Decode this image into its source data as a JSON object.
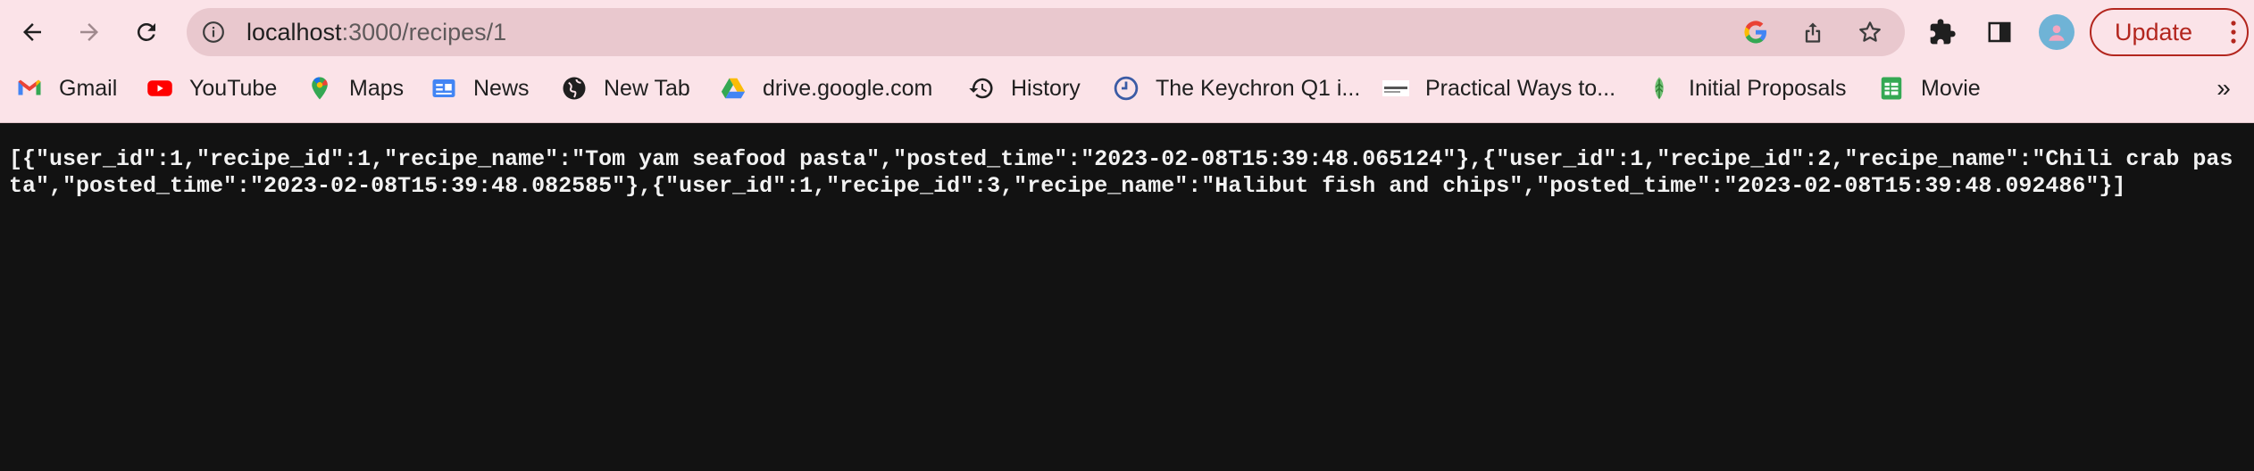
{
  "browser": {
    "url_host": "localhost",
    "url_path": ":3000/recipes/1",
    "update_label": "Update",
    "theme_color": "#fbe3e8",
    "update_color": "#b3261e"
  },
  "bookmarks": [
    {
      "label": "Gmail",
      "icon": "gmail-icon"
    },
    {
      "label": "YouTube",
      "icon": "youtube-icon"
    },
    {
      "label": "Maps",
      "icon": "maps-icon"
    },
    {
      "label": "News",
      "icon": "news-icon"
    },
    {
      "label": "New Tab",
      "icon": "globe-icon"
    },
    {
      "label": "drive.google.com",
      "icon": "drive-icon"
    },
    {
      "label": "History",
      "icon": "history-icon"
    },
    {
      "label": "The Keychron Q1 i...",
      "icon": "clock-icon"
    },
    {
      "label": "Practical Ways to...",
      "icon": "site-icon"
    },
    {
      "label": "Initial Proposals",
      "icon": "leaf-icon"
    },
    {
      "label": "Movie",
      "icon": "sheets-icon"
    }
  ],
  "bookmarks_more": "»",
  "content": {
    "json_text": "[{\"user_id\":1,\"recipe_id\":1,\"recipe_name\":\"Tom yam seafood pasta\",\"posted_time\":\"2023-02-08T15:39:48.065124\"},{\"user_id\":1,\"recipe_id\":2,\"recipe_name\":\"Chili crab pasta\",\"posted_time\":\"2023-02-08T15:39:48.082585\"},{\"user_id\":1,\"recipe_id\":3,\"recipe_name\":\"Halibut fish and chips\",\"posted_time\":\"2023-02-08T15:39:48.092486\"}]"
  }
}
